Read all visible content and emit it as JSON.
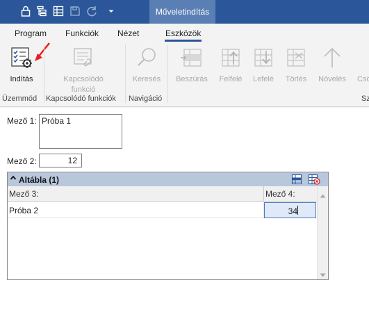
{
  "app": {
    "context_tab": "Műveletindítás"
  },
  "qat": {
    "icons": [
      "lock-icon",
      "tree-icon",
      "grid-icon",
      "save-icon",
      "redo-icon",
      "dropdown-icon"
    ]
  },
  "ribbon_tabs": [
    {
      "label": "Program"
    },
    {
      "label": "Funkciók"
    },
    {
      "label": "Nézet"
    },
    {
      "label": "Eszközök",
      "active": true
    }
  ],
  "ribbon": {
    "buttons": [
      {
        "label": "Indítás",
        "enabled": true
      },
      {
        "label": "Kapcsolódó\nfunkció",
        "enabled": false
      },
      {
        "label": "Keresés",
        "enabled": false
      },
      {
        "label": "Beszúrás",
        "enabled": false
      },
      {
        "label": "Felfelé",
        "enabled": false
      },
      {
        "label": "Lefelé",
        "enabled": false
      },
      {
        "label": "Törlés",
        "enabled": false
      },
      {
        "label": "Növelés",
        "enabled": false
      },
      {
        "label": "Csö",
        "enabled": false
      }
    ],
    "groups": [
      "Üzemmód",
      "Kapcsolódó funkciók",
      "Navigáció",
      "Sz"
    ]
  },
  "form": {
    "field1_label": "Mező 1:",
    "field1_value": "Próba 1",
    "field2_label": "Mező 2:",
    "field2_value": "12"
  },
  "subtable": {
    "title": "Altábla (1)",
    "columns": [
      "Mező 3:",
      "Mező 4:"
    ],
    "rows": [
      {
        "col3": "Próba 2",
        "col4": "34"
      }
    ]
  },
  "colors": {
    "titlebar": "#2b579a",
    "context_tab": "#5a7fb5",
    "subtable_header": "#b8c7dc",
    "selected_cell": "#dfe9f7",
    "annotation_arrow": "#e8201c"
  }
}
